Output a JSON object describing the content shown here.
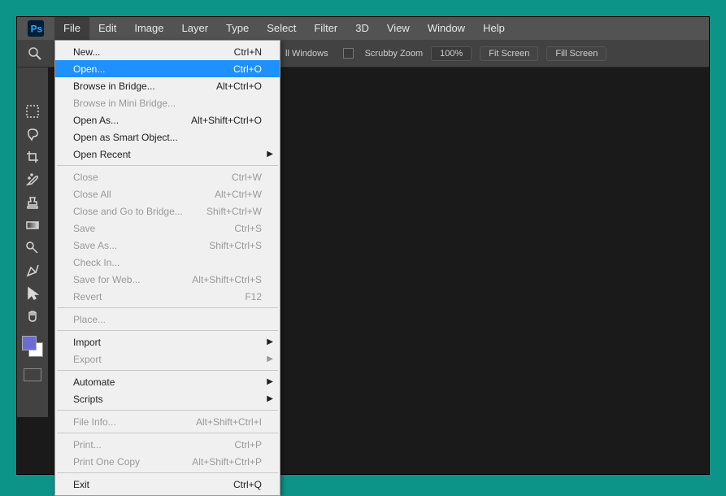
{
  "menubar": [
    "File",
    "Edit",
    "Image",
    "Layer",
    "Type",
    "Select",
    "Filter",
    "3D",
    "View",
    "Window",
    "Help"
  ],
  "options": {
    "all_windows_label": "ll Windows",
    "scrubby_label": "Scrubby Zoom",
    "zoom_value": "100%",
    "fit_label": "Fit Screen",
    "fill_label": "Fill Screen"
  },
  "menu": {
    "sections": [
      [
        {
          "label": "New...",
          "shortcut": "Ctrl+N"
        },
        {
          "label": "Open...",
          "shortcut": "Ctrl+O",
          "hl": true
        },
        {
          "label": "Browse in Bridge...",
          "shortcut": "Alt+Ctrl+O"
        },
        {
          "label": "Browse in Mini Bridge...",
          "disabled": true
        },
        {
          "label": "Open As...",
          "shortcut": "Alt+Shift+Ctrl+O"
        },
        {
          "label": "Open as Smart Object..."
        },
        {
          "label": "Open Recent",
          "sub": true
        }
      ],
      [
        {
          "label": "Close",
          "shortcut": "Ctrl+W",
          "disabled": true
        },
        {
          "label": "Close All",
          "shortcut": "Alt+Ctrl+W",
          "disabled": true
        },
        {
          "label": "Close and Go to Bridge...",
          "shortcut": "Shift+Ctrl+W",
          "disabled": true
        },
        {
          "label": "Save",
          "shortcut": "Ctrl+S",
          "disabled": true
        },
        {
          "label": "Save As...",
          "shortcut": "Shift+Ctrl+S",
          "disabled": true
        },
        {
          "label": "Check In...",
          "disabled": true
        },
        {
          "label": "Save for Web...",
          "shortcut": "Alt+Shift+Ctrl+S",
          "disabled": true
        },
        {
          "label": "Revert",
          "shortcut": "F12",
          "disabled": true
        }
      ],
      [
        {
          "label": "Place...",
          "disabled": true
        }
      ],
      [
        {
          "label": "Import",
          "sub": true
        },
        {
          "label": "Export",
          "sub": true,
          "disabled": true
        }
      ],
      [
        {
          "label": "Automate",
          "sub": true
        },
        {
          "label": "Scripts",
          "sub": true
        }
      ],
      [
        {
          "label": "File Info...",
          "shortcut": "Alt+Shift+Ctrl+I",
          "disabled": true
        }
      ],
      [
        {
          "label": "Print...",
          "shortcut": "Ctrl+P",
          "disabled": true
        },
        {
          "label": "Print One Copy",
          "shortcut": "Alt+Shift+Ctrl+P",
          "disabled": true
        }
      ],
      [
        {
          "label": "Exit",
          "shortcut": "Ctrl+Q"
        }
      ]
    ]
  }
}
